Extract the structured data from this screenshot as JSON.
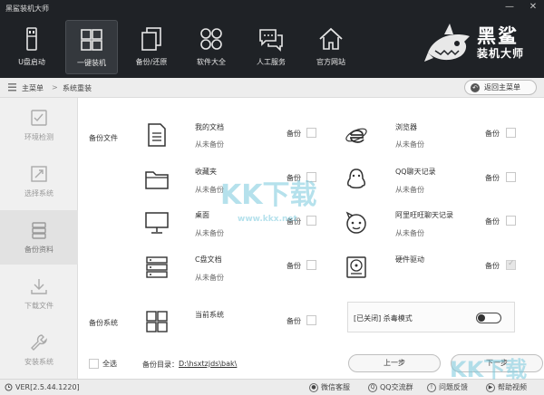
{
  "window": {
    "title": "黑鲨装机大师",
    "minimize": "—",
    "close": "✕"
  },
  "nav": [
    {
      "label": "U盘启动",
      "icon": "usb-drive-icon"
    },
    {
      "label": "一键装机",
      "icon": "windows-icon",
      "active": true
    },
    {
      "label": "备份/还原",
      "icon": "copy-icon"
    },
    {
      "label": "软件大全",
      "icon": "grid-apps-icon"
    },
    {
      "label": "人工服务",
      "icon": "chat-icon"
    },
    {
      "label": "官方网站",
      "icon": "home-icon"
    }
  ],
  "brand": {
    "line1": "黑鲨",
    "line2": "装机大师"
  },
  "breadcrumb": {
    "home": "主菜单",
    "separator": ">",
    "current": "系统重装",
    "back_label": "返回主菜单"
  },
  "sidebar": [
    {
      "label": "环境检测",
      "icon": "checklist-icon"
    },
    {
      "label": "选择系统",
      "icon": "system-select-icon"
    },
    {
      "label": "备份资料",
      "icon": "backup-data-icon",
      "active": true
    },
    {
      "label": "下载文件",
      "icon": "download-icon"
    },
    {
      "label": "安装系统",
      "icon": "wrench-icon"
    }
  ],
  "files": {
    "section_label": "备份文件",
    "backup_label": "备份",
    "left": [
      {
        "name": "我的文档",
        "status": "从未备份",
        "icon": "document-icon"
      },
      {
        "name": "收藏夹",
        "status": "从未备份",
        "icon": "folder-icon"
      },
      {
        "name": "桌面",
        "status": "从未备份",
        "icon": "monitor-icon"
      },
      {
        "name": "C盘文档",
        "status": "从未备份",
        "icon": "server-icon"
      }
    ],
    "right": [
      {
        "name": "浏览器",
        "status": "从未备份",
        "icon": "ie-browser-icon"
      },
      {
        "name": "QQ聊天记录",
        "status": "从未备份",
        "icon": "qq-penguin-icon"
      },
      {
        "name": "阿里旺旺聊天记录",
        "status": "从未备份",
        "icon": "wangwang-icon"
      },
      {
        "name": "硬件驱动",
        "status": "",
        "icon": "hard-disk-icon"
      }
    ]
  },
  "system": {
    "section_label": "备份系统",
    "name": "当前系统",
    "backup_label": "备份"
  },
  "antivirus": {
    "label": "[已关闭] 杀毒模式"
  },
  "footer": {
    "select_all": "全选",
    "dir_label": "备份目录：",
    "dir_path": "D:\\hsxtzjds\\bak\\",
    "prev": "上一步",
    "next": "下一步"
  },
  "statusbar": {
    "version": "VER[2.5.44.1220]",
    "links": [
      "微信客服",
      "QQ交流群",
      "问题反馈",
      "帮助视频"
    ]
  },
  "watermark": {
    "main": "KK下载",
    "url": "www.kkx.net",
    "corner": "KK下载"
  }
}
